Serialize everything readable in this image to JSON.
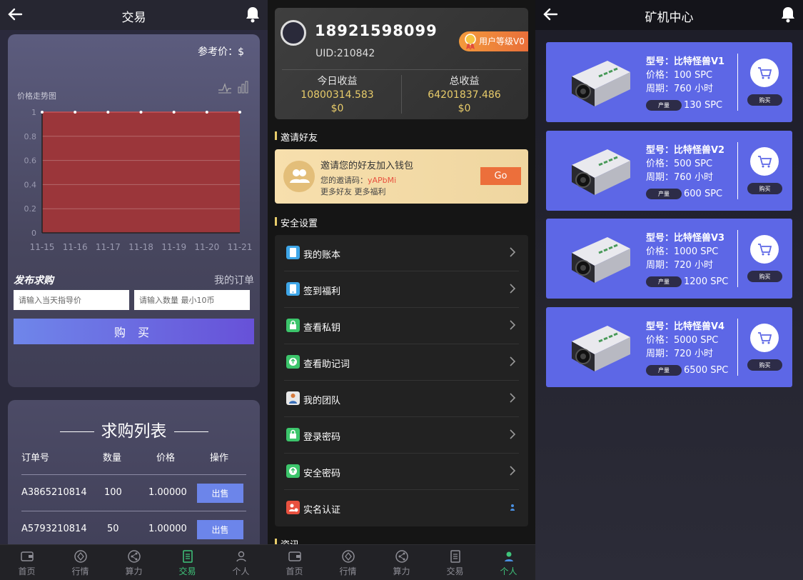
{
  "screen_trade": {
    "title": "交易",
    "ref_price": "参考价：$",
    "chart_title": "价格走势图",
    "publish_label": "发布求购",
    "my_orders": "我的订单",
    "price_placeholder": "请输入当天指导价",
    "qty_placeholder": "请输入数量 最小10币",
    "buy_label": "购 买",
    "list_title": "求购列表",
    "columns": [
      "订单号",
      "数量",
      "价格",
      "操作"
    ],
    "rows": [
      {
        "order": "A3865210814",
        "qty": "100",
        "price": "1.00000",
        "action": "出售"
      },
      {
        "order": "A5793210814",
        "qty": "50",
        "price": "1.00000",
        "action": "出售"
      }
    ]
  },
  "chart_data": {
    "type": "area",
    "title": "价格走势图",
    "categories": [
      "11-15",
      "11-16",
      "11-17",
      "11-18",
      "11-19",
      "11-20",
      "11-21"
    ],
    "values": [
      1,
      1,
      1,
      1,
      1,
      1,
      1
    ],
    "y_ticks": [
      "0",
      "0.2",
      "0.4",
      "0.6",
      "0.8",
      "1"
    ],
    "ylim": [
      0,
      1
    ],
    "grid": true,
    "fill_color": "#9b363a"
  },
  "screen_profile": {
    "phone": "18921598099",
    "uid": "UID:210842",
    "level": "用户等级V0",
    "today_label": "今日收益",
    "today_value": "10800314.583",
    "today_usd": "$0",
    "total_label": "总收益",
    "total_value": "64201837.486",
    "total_usd": "$0",
    "invite_section": "邀请好友",
    "invite_title": "邀请您的好友加入钱包",
    "invite_code_label": "您的邀请码：",
    "invite_code": "yAPbMi",
    "invite_more": "更多好友 更多福利",
    "go_label": "Go",
    "security_section": "安全设置",
    "security_items": [
      {
        "label": "我的账本",
        "icon": "ledger-icon",
        "color": "#3ea6e8"
      },
      {
        "label": "签到福利",
        "icon": "checkin-icon",
        "color": "#3ea6e8"
      },
      {
        "label": "查看私钥",
        "icon": "lock-icon",
        "color": "#3cc56b"
      },
      {
        "label": "查看助记词",
        "icon": "mnemonic-icon",
        "color": "#3cc56b"
      },
      {
        "label": "我的团队",
        "icon": "team-icon",
        "color": "#e8e8e8"
      },
      {
        "label": "登录密码",
        "icon": "lock-icon",
        "color": "#3cc56b"
      },
      {
        "label": "安全密码",
        "icon": "shield-icon",
        "color": "#3cc56b"
      },
      {
        "label": "实名认证",
        "icon": "id-icon",
        "color": "#e8513f"
      }
    ],
    "next_section": "资讯"
  },
  "screen_miners": {
    "title": "矿机中心",
    "miners": [
      {
        "model": "型号：比特怪兽V1",
        "price": "价格：100 SPC",
        "period": "周期：760 小时",
        "output_label": "产量",
        "output": "130 SPC",
        "buy": "购买"
      },
      {
        "model": "型号：比特怪兽V2",
        "price": "价格：500 SPC",
        "period": "周期：760 小时",
        "output_label": "产量",
        "output": "600 SPC",
        "buy": "购买"
      },
      {
        "model": "型号：比特怪兽V3",
        "price": "价格：1000 SPC",
        "period": "周期：720 小时",
        "output_label": "产量",
        "output": "1200 SPC",
        "buy": "购买"
      },
      {
        "model": "型号：比特怪兽V4",
        "price": "价格：5000 SPC",
        "period": "周期：720 小时",
        "output_label": "产量",
        "output": "6500 SPC",
        "buy": "购买"
      }
    ]
  },
  "tabbar": {
    "tabs": [
      "首页",
      "行情",
      "算力",
      "交易",
      "个人"
    ],
    "active_color": "#3fc57b"
  }
}
